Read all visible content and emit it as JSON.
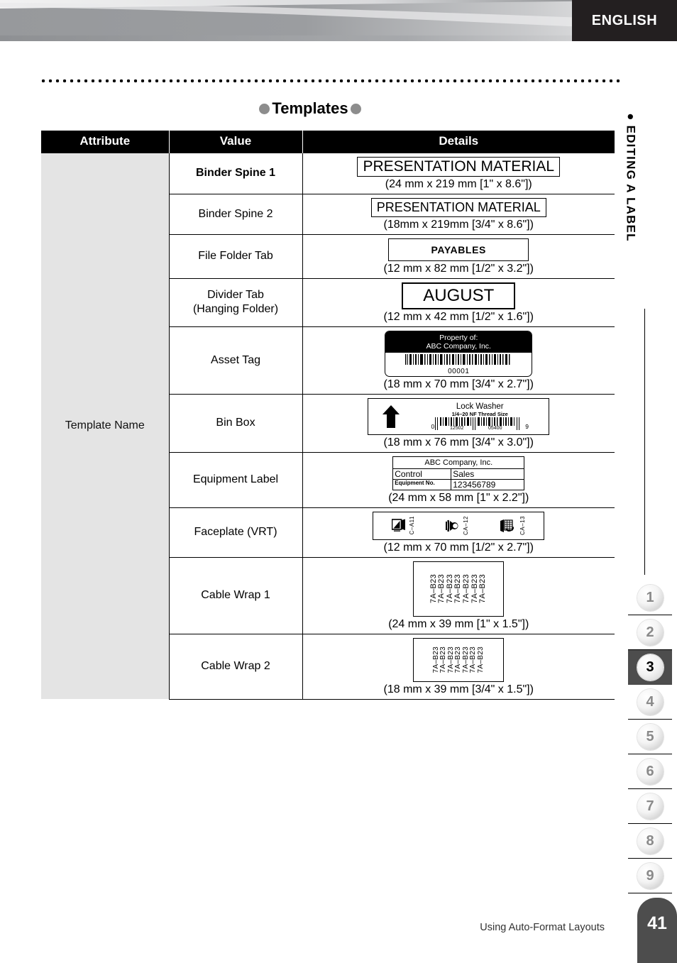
{
  "header": {
    "language": "ENGLISH"
  },
  "sidebar": {
    "chapter_label": "EDITING A LABEL",
    "chapter_bullet": "bullet-icon",
    "tabs": [
      {
        "number": "1",
        "active": false
      },
      {
        "number": "2",
        "active": false
      },
      {
        "number": "3",
        "active": true
      },
      {
        "number": "4",
        "active": false
      },
      {
        "number": "5",
        "active": false
      },
      {
        "number": "6",
        "active": false
      },
      {
        "number": "7",
        "active": false
      },
      {
        "number": "8",
        "active": false
      },
      {
        "number": "9",
        "active": false
      }
    ]
  },
  "section": {
    "title": "Templates"
  },
  "table": {
    "columns": [
      "Attribute",
      "Value",
      "Details"
    ],
    "attribute": "Template Name",
    "rows": [
      {
        "value": "Binder Spine 1",
        "value_bold": true,
        "dims": "(24 mm x 219 mm [1\" x 8.6\"])",
        "sample_type": "text-label",
        "sample_text": "PRESENTATION MATERIAL"
      },
      {
        "value": "Binder Spine 2",
        "value_bold": false,
        "dims": "(18mm x 219mm [3/4\" x 8.6\"])",
        "sample_type": "text-label",
        "sample_text": "PRESENTATION MATERIAL"
      },
      {
        "value": "File Folder Tab",
        "value_bold": false,
        "dims": "(12 mm x 82 mm [1/2\" x 3.2\"])",
        "sample_type": "text-label",
        "sample_text": "PAYABLES"
      },
      {
        "value": "Divider Tab\n(Hanging Folder)",
        "value_line1": "Divider Tab",
        "value_line2": "(Hanging Folder)",
        "value_bold": false,
        "dims": "(12 mm x 42 mm [1/2\" x 1.6\"])",
        "sample_type": "text-label",
        "sample_text": "AUGUST"
      },
      {
        "value": "Asset Tag",
        "value_bold": false,
        "dims": "(18 mm x 70 mm [3/4\" x 2.7\"])",
        "sample_type": "asset-tag",
        "sample_line1": "Property of:",
        "sample_line2": "ABC Company, Inc.",
        "sample_barcode_text": " 00001 "
      },
      {
        "value": "Bin Box",
        "value_bold": false,
        "dims": "(18 mm x 76 mm [3/4\" x 3.0\"])",
        "sample_type": "bin-box",
        "sample_line1": "Lock Washer",
        "sample_line2": "1/4–20 NF Thread Size",
        "sample_ean_left": "0",
        "sample_ean_mid1": "12502",
        "sample_ean_mid2": "05400",
        "sample_ean_right": "9"
      },
      {
        "value": "Equipment Label",
        "value_bold": false,
        "dims": "(24 mm x 58 mm [1\" x 2.2\"])",
        "sample_type": "equipment-label",
        "sample_company": "ABC Company, Inc.",
        "sample_c1": "Control",
        "sample_c2": "Sales",
        "sample_c3": "Equipment No.",
        "sample_c4": "123456789"
      },
      {
        "value": "Faceplate (VRT)",
        "value_bold": false,
        "dims": "(12 mm x 70 mm [1/2\" x 2.7\"])",
        "sample_type": "faceplate",
        "sample_codes": [
          "C–A11",
          "CA–12",
          "CA–13"
        ]
      },
      {
        "value": "Cable Wrap 1",
        "value_bold": false,
        "dims": "(24 mm x 39 mm [1\" x 1.5\"])",
        "sample_type": "cable-wrap",
        "sample_lines": [
          "7A–B23",
          "7A–B23",
          "7A–B23",
          "7A–B23",
          "7A–B23",
          "7A–B23",
          "7A–B23"
        ]
      },
      {
        "value": "Cable Wrap 2",
        "value_bold": false,
        "dims": "(18 mm x 39 mm [3/4\" x 1.5\"])",
        "sample_type": "cable-wrap",
        "sample_lines": [
          "7A–B23",
          "7A–B23",
          "7A–B23",
          "7A–B23",
          "7A–B23",
          "7A–B23",
          "7A–B23"
        ]
      }
    ]
  },
  "footer": {
    "section_title": "Using Auto-Format Layouts",
    "page_number": "41"
  },
  "colors": {
    "header_dark": "#231f20",
    "tab_active": "#4d4d4d",
    "attr_cell_bg": "#e4e4e4",
    "bullet_gray": "#8d8d8d"
  }
}
